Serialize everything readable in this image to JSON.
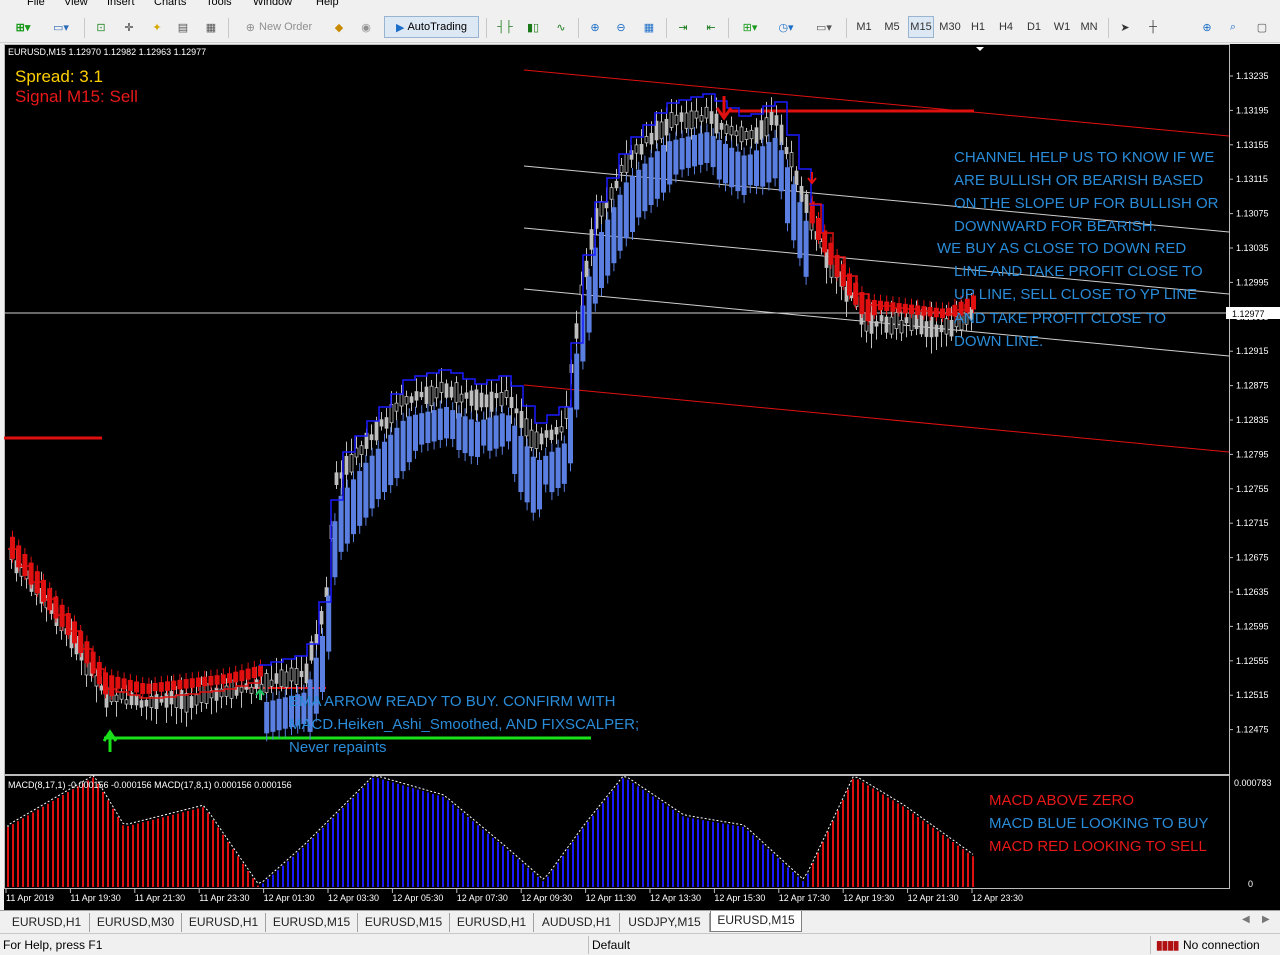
{
  "menu": [
    "File",
    "View",
    "Insert",
    "Charts",
    "Tools",
    "Window",
    "Help"
  ],
  "toolbar": {
    "new_order": "New Order",
    "autotrading": "AutoTrading",
    "timeframes": [
      "M1",
      "M5",
      "M15",
      "M30",
      "H1",
      "H4",
      "D1",
      "W1",
      "MN"
    ],
    "active_timeframe": "M15"
  },
  "chart": {
    "header": "EURUSD,M15  1.12970 1.12982 1.12963 1.12977",
    "spread_label": "Spread: 3.1",
    "signal_label": "Signal M15: Sell",
    "current_price": "1.12977",
    "price_ticks": [
      "1.13235",
      "1.13195",
      "1.13155",
      "1.13115",
      "1.13075",
      "1.13035",
      "1.12995",
      "1.12955",
      "1.12915",
      "1.12875",
      "1.12835",
      "1.12795",
      "1.12755",
      "1.12715",
      "1.12675",
      "1.12635",
      "1.12595",
      "1.12555",
      "1.12515",
      "1.12475"
    ],
    "channel_note": [
      "CHANNEL HELP US TO KNOW IF WE",
      "ARE BULLISH OR BEARISH BASED",
      "ON THE SLOPE UP FOR BULLISH OR",
      "DOWNWARD FOR BEARISH.",
      "WE BUY AS CLOSE TO DOWN  RED",
      "LINE AND TAKE PROFIT CLOSE TO",
      "UP LINE, SELL CLOSE TO YP LINE",
      "AND TAKE PROFIT CLOSE TO",
      "DOWN LINE."
    ],
    "ema_note": [
      "EMA ARROW READY TO BUY. CONFIRM WITH",
      "MACD.Heiken_Ashi_Smoothed, AND FIXSCALPER;",
      "Never repaints"
    ]
  },
  "macd": {
    "header": "MACD(8,17,1) -0.000156 -0.000156  MACD(17,8,1) 0.000156 0.000156",
    "top_tick": "0.000783",
    "zero_tick": "0",
    "notes": [
      "MACD ABOVE ZERO",
      "MACD BLUE LOOKING TO BUY",
      "MACD RED LOOKING TO SELL"
    ]
  },
  "time_axis": [
    "11 Apr 2019",
    "11 Apr 19:30",
    "11 Apr 21:30",
    "11 Apr 23:30",
    "12 Apr 01:30",
    "12 Apr 03:30",
    "12 Apr 05:30",
    "12 Apr 07:30",
    "12 Apr 09:30",
    "12 Apr 11:30",
    "12 Apr 13:30",
    "12 Apr 15:30",
    "12 Apr 17:30",
    "12 Apr 19:30",
    "12 Apr 21:30",
    "12 Apr 23:30"
  ],
  "tabs": [
    "EURUSD,H1",
    "EURUSD,M30",
    "EURUSD,H1",
    "EURUSD,M15",
    "EURUSD,M15",
    "EURUSD,H1",
    "AUDUSD,H1",
    "USDJPY,M15",
    "EURUSD,M15"
  ],
  "status": {
    "help": "For Help, press F1",
    "profile": "Default",
    "connection": "No connection"
  },
  "colors": {
    "background": "#000000",
    "bull_candle": "#5a7fe0",
    "bear_candle": "#e01010",
    "channel_red": "#e01010",
    "note_blue": "#2a8cd8",
    "note_red": "#e81818",
    "spread_yellow": "#ffd000",
    "ema_green": "#19e019"
  }
}
